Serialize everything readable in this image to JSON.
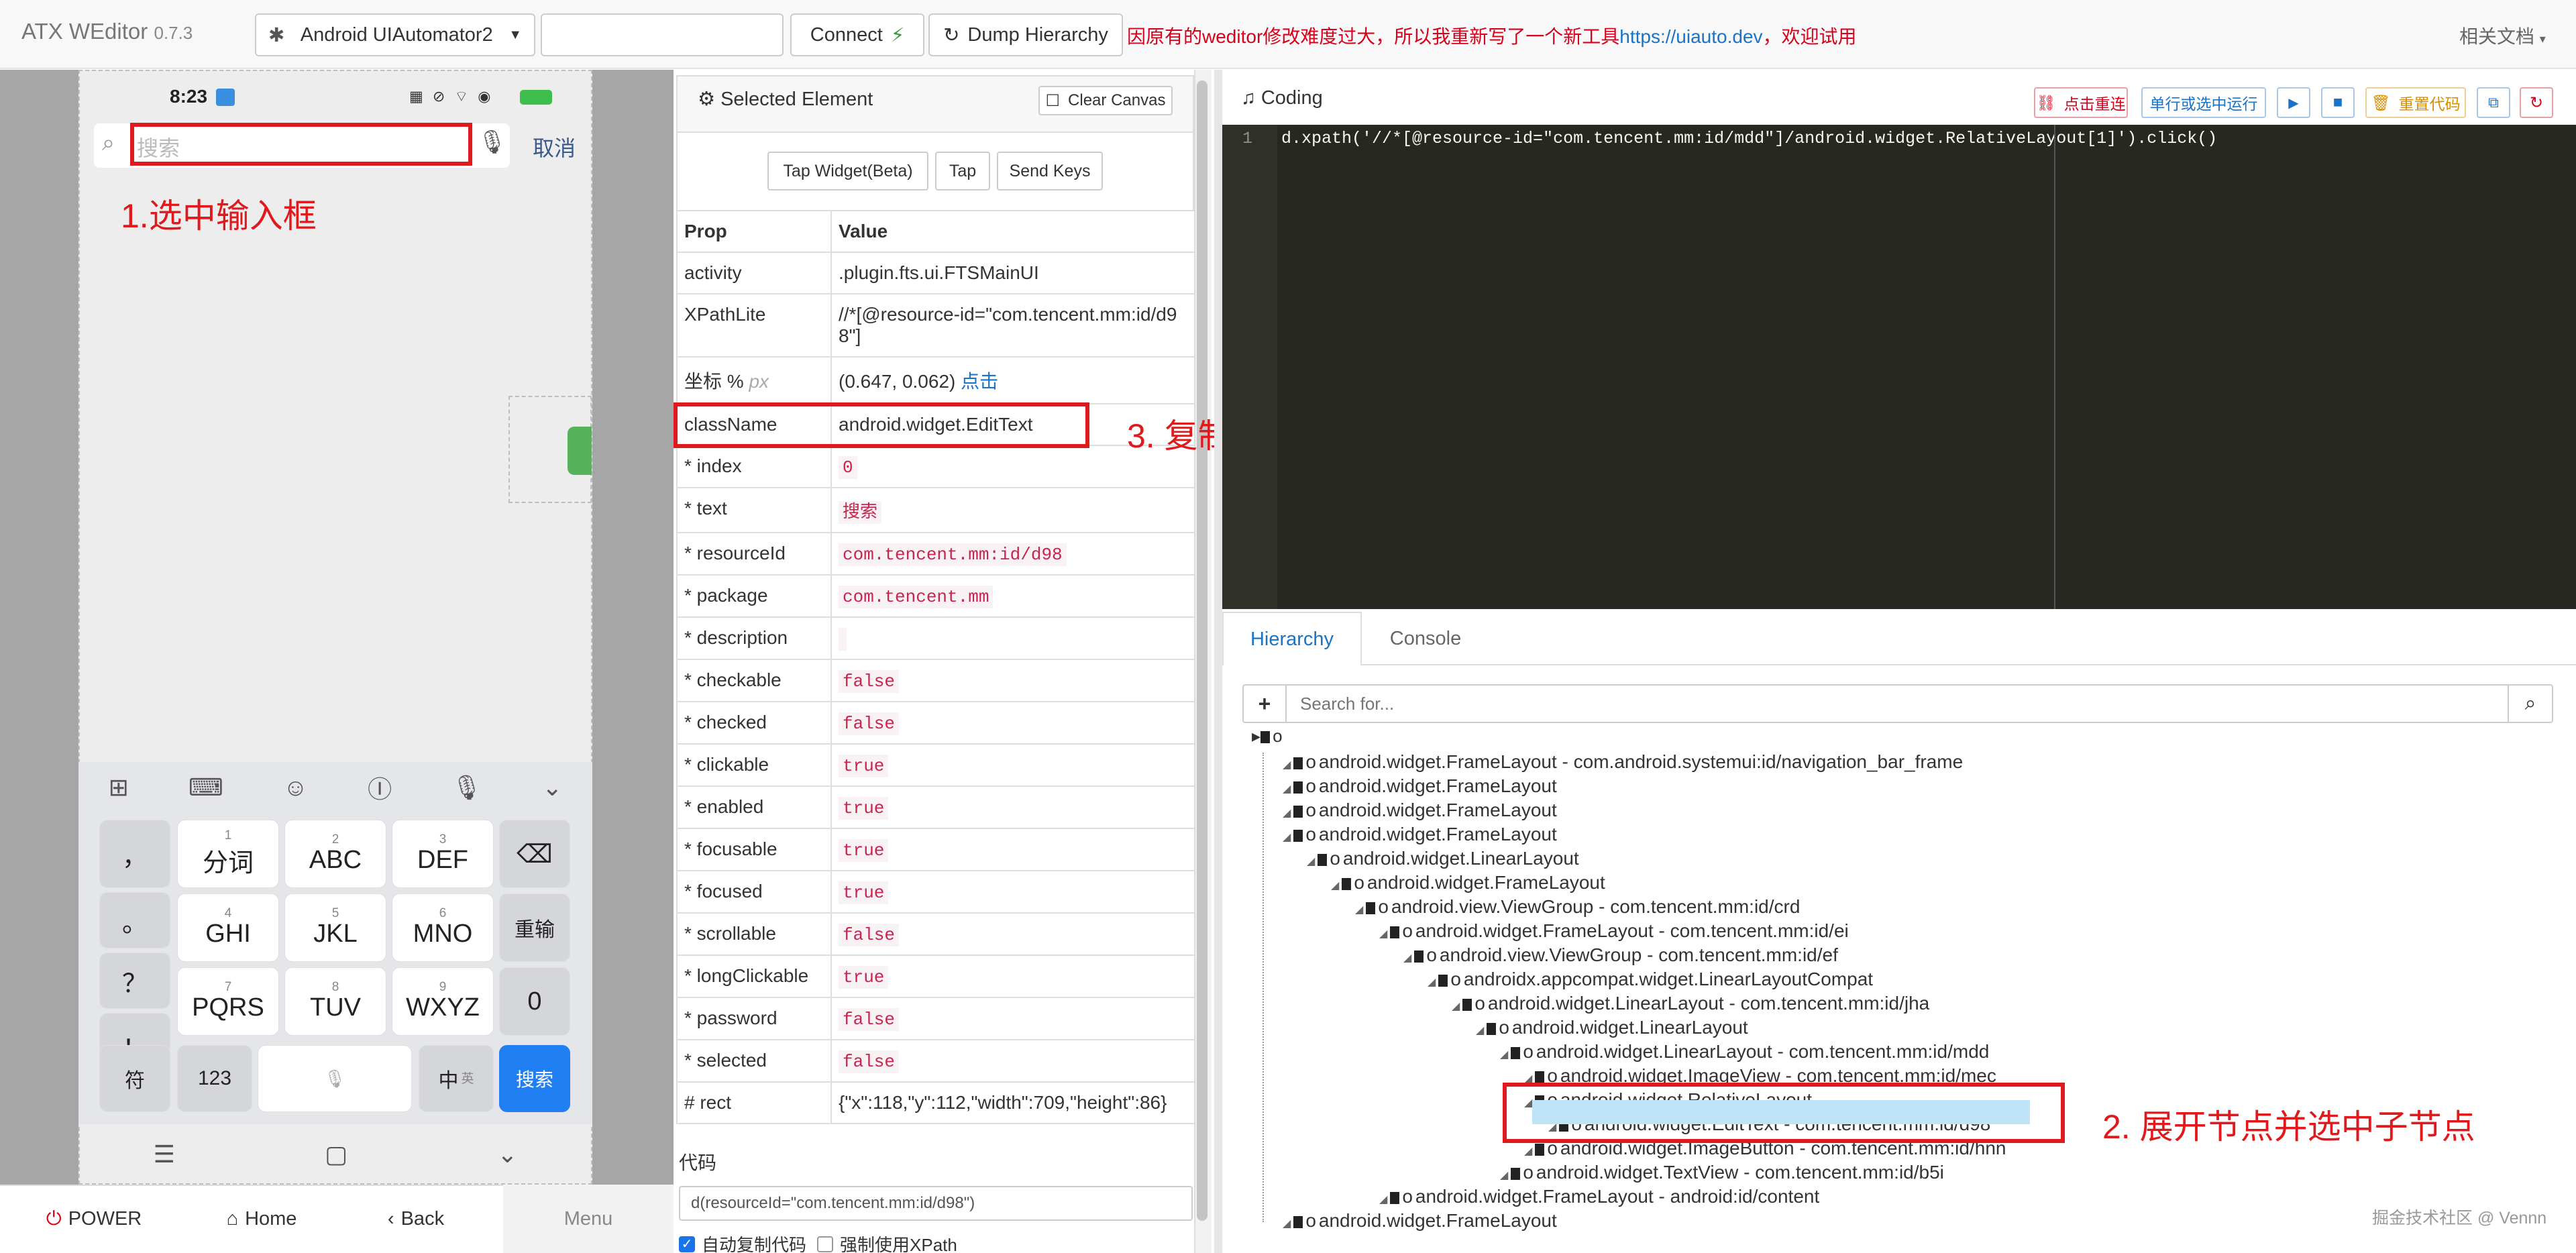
{
  "header": {
    "brand": "ATX WEditor",
    "version": "0.7.3",
    "platform_select": "Android UIAutomator2",
    "device_input": "",
    "connect": "Connect",
    "dump": "Dump Hierarchy",
    "notice": "因原有的weditor修改难度过大，所以我重新写了一个新工具",
    "notice_link": "https://uiauto.dev",
    "notice_tail": "，欢迎试用",
    "docs": "相关文档"
  },
  "device": {
    "time": "8:23",
    "search_placeholder": "搜索",
    "cancel": "取消",
    "annotation_1": "1.选中输入框",
    "keys": {
      "comma": "，",
      "period": "。",
      "question": "？",
      "exclaim": "！",
      "k_fenci": "分词",
      "k_abc": "ABC",
      "k_def": "DEF",
      "k_ghi": "GHI",
      "k_jkl": "JKL",
      "k_mno": "MNO",
      "k_pqrs": "PQRS",
      "k_tuv": "TUV",
      "k_wxyz": "WXYZ",
      "n1": "1",
      "n2": "2",
      "n3": "3",
      "n4": "4",
      "n5": "5",
      "n6": "6",
      "n7": "7",
      "n8": "8",
      "n9": "9",
      "zero": "0",
      "reinput": "重输",
      "symbol": "符",
      "num": "123",
      "chinese": "中",
      "chinese_sub": "英",
      "search": "搜索"
    },
    "power": "POWER",
    "home": "Home",
    "back": "Back",
    "menu": "Menu"
  },
  "selected": {
    "title": "Selected Element",
    "clear": "Clear Canvas",
    "tap_widget": "Tap Widget(Beta)",
    "tap": "Tap",
    "send_keys": "Send Keys",
    "col_prop": "Prop",
    "col_value": "Value",
    "coord_label": "坐标 %",
    "coord_px": "px",
    "coord_value": "(0.647, 0.062)",
    "coord_click": "点击",
    "rows": [
      {
        "p": "activity",
        "v": ".plugin.fts.ui.FTSMainUI"
      },
      {
        "p": "XPathLite",
        "v": "//*[@resource-id=\"com.tencent.mm:id/d98\"]"
      }
    ],
    "classname_label": "className",
    "classname_value": "android.widget.EditText",
    "annotation_3": "3. 复制节点类型",
    "code_rows": [
      {
        "p": "* index",
        "v": "0"
      },
      {
        "p": "* text",
        "v": "搜索"
      },
      {
        "p": "* resourceId",
        "v": "com.tencent.mm:id/d98"
      },
      {
        "p": "* package",
        "v": "com.tencent.mm"
      },
      {
        "p": "* description",
        "v": ""
      },
      {
        "p": "* checkable",
        "v": "false"
      },
      {
        "p": "* checked",
        "v": "false"
      },
      {
        "p": "* clickable",
        "v": "true"
      },
      {
        "p": "* enabled",
        "v": "true"
      },
      {
        "p": "* focusable",
        "v": "true"
      },
      {
        "p": "* focused",
        "v": "true"
      },
      {
        "p": "* scrollable",
        "v": "false"
      },
      {
        "p": "* longClickable",
        "v": "true"
      },
      {
        "p": "* password",
        "v": "false"
      },
      {
        "p": "* selected",
        "v": "false"
      }
    ],
    "rect_label": "# rect",
    "rect_value": "{\"x\":118,\"y\":112,\"width\":709,\"height\":86}",
    "code_label": "代码",
    "code_value": "d(resourceId=\"com.tencent.mm:id/d98\")",
    "auto_copy": "自动复制代码",
    "force_xpath": "强制使用XPath"
  },
  "coding": {
    "title": "Coding",
    "reconnect": "点击重连",
    "run_line": "单行或选中运行",
    "reset": "重置代码",
    "line_no": "1",
    "code": "d.xpath('//*[@resource-id=\"com.tencent.mm:id/mdd\"]/android.widget.RelativeLayout[1]').click()"
  },
  "hierarchy": {
    "tab_hierarchy": "Hierarchy",
    "tab_console": "Console",
    "search_placeholder": "Search for...",
    "annotation_2": "2. 展开节点并选中子节点",
    "nodes": [
      {
        "t": "android.widget.FrameLayout - com.android.systemui:id/navigation_bar_frame",
        "d": 1
      },
      {
        "t": "android.widget.FrameLayout",
        "d": 1
      },
      {
        "t": "android.widget.FrameLayout",
        "d": 1
      },
      {
        "t": "android.widget.FrameLayout",
        "d": 1
      },
      {
        "t": "android.widget.LinearLayout",
        "d": 2
      },
      {
        "t": "android.widget.FrameLayout",
        "d": 3
      },
      {
        "t": "android.view.ViewGroup - com.tencent.mm:id/crd",
        "d": 4
      },
      {
        "t": "android.widget.FrameLayout - com.tencent.mm:id/ei",
        "d": 5
      },
      {
        "t": "android.view.ViewGroup - com.tencent.mm:id/ef",
        "d": 6
      },
      {
        "t": "androidx.appcompat.widget.LinearLayoutCompat",
        "d": 7
      },
      {
        "t": "android.widget.LinearLayout - com.tencent.mm:id/jha",
        "d": 8
      },
      {
        "t": "android.widget.LinearLayout",
        "d": 9
      },
      {
        "t": "android.widget.LinearLayout - com.tencent.mm:id/mdd",
        "d": 10
      },
      {
        "t": "android.widget.ImageView - com.tencent.mm:id/mec",
        "d": 11
      },
      {
        "t": "android.widget.RelativeLayout",
        "d": 11
      },
      {
        "t": "android.widget.EditText - com.tencent.mm:id/d98",
        "d": 12
      },
      {
        "t": "android.widget.ImageButton - com.tencent.mm:id/hnn",
        "d": 11
      },
      {
        "t": "android.widget.TextView - com.tencent.mm:id/b5i",
        "d": 10
      },
      {
        "t": "android.widget.FrameLayout - android:id/content",
        "d": 5
      },
      {
        "t": "android.widget.FrameLayout",
        "d": 1
      }
    ]
  },
  "watermark": "掘金技术社区 @ Vennn"
}
